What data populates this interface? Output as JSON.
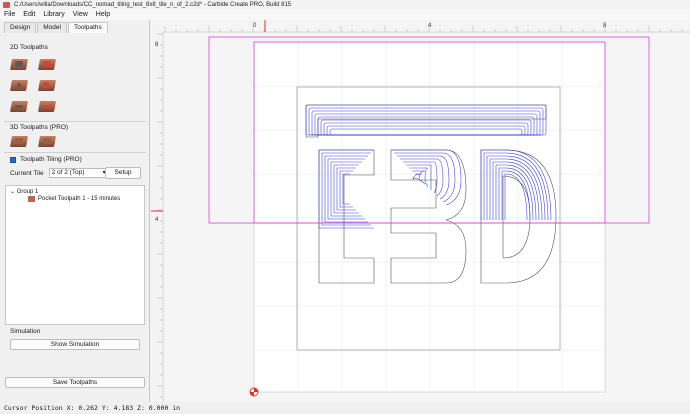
{
  "window": {
    "title": "C:/Users/willa/Downloads/CC_nomad_tiling_test_8x8_tile_n_of_2.c2d* - Carbide Create PRO, Build 815"
  },
  "menu": [
    "File",
    "Edit",
    "Library",
    "View",
    "Help"
  ],
  "tabs": [
    "Design",
    "Model",
    "Toolpaths"
  ],
  "active_tab": "Toolpaths",
  "toolpaths_2d_label": "2D Toolpaths",
  "toolpaths_3d_label": "3D Toolpaths (PRO)",
  "tiling": {
    "label": "Toolpath Tiling (PRO)",
    "checked": true,
    "current_tile_label": "Current Tile",
    "current_tile_value": "2 of 2 (Top)",
    "setup_label": "Setup"
  },
  "tree": {
    "group": "Group 1",
    "item": "Pocket Toolpath 1 - 15 minutes"
  },
  "simulation": {
    "label": "Simulation",
    "button": "Show Simulation"
  },
  "save_button": "Save Toolpaths",
  "ruler": {
    "top_labels": [
      "0",
      "4",
      "8"
    ],
    "left_labels": [
      "8",
      "4"
    ]
  },
  "status": "Cursor Position X: 0.262 Y: 4.183 Z: 0.000 in",
  "colors": {
    "toolpath": "#3a3adb",
    "tile_boundary": "#e040e0",
    "origin": "#e53030",
    "checkbox": "#2a65c8"
  },
  "icons": {
    "app": "carbide-create-icon",
    "chevron": "chevron-down-icon"
  }
}
